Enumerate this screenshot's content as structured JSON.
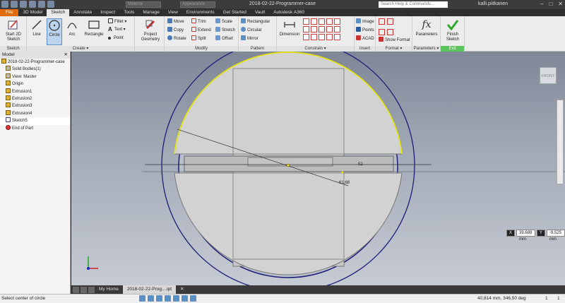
{
  "titlebar": {
    "material_field": "Material",
    "appearance_field": "Appearance",
    "document_title": "2018-02-22-Programmer-case",
    "search_placeholder": "Search Help & Commands...",
    "user_name": "kalli.piitkanen",
    "minimize": "–",
    "maximize": "□",
    "close": "✕"
  },
  "tabs": [
    "File",
    "3D Model",
    "Sketch",
    "Annotate",
    "Inspect",
    "Tools",
    "Manage",
    "View",
    "Environments",
    "Get Started",
    "Vault",
    "Autodesk A360"
  ],
  "active_tab": "Sketch",
  "ribbon": {
    "sketch_group": {
      "label": "Sketch",
      "start_2d_sketch": "Start 2D Sketch"
    },
    "create_group": {
      "label": "Create ▾",
      "line": "Line",
      "circle": "Circle",
      "arc": "Arc",
      "rectangle": "Rectangle",
      "fillet": "Fillet ▾",
      "text": "Text ▾",
      "point": "Point"
    },
    "project_geometry": "Project Geometry",
    "modify_group": {
      "label": "Modify",
      "move": "Move",
      "copy": "Copy",
      "rotate": "Rotate",
      "trim": "Trim",
      "extend": "Extend",
      "split": "Split",
      "scale": "Scale",
      "stretch": "Stretch",
      "offset": "Offset"
    },
    "pattern_group": {
      "label": "Pattern",
      "rectangular": "Rectangular",
      "circular": "Circular",
      "mirror": "Mirror"
    },
    "constrain_group": {
      "label": "Constrain ▾",
      "dimension": "Dimension"
    },
    "insert_group": {
      "label": "Insert",
      "image": "Image",
      "points": "Points",
      "acad": "ACAD"
    },
    "format_group": {
      "label": "Format ▾",
      "show_format": "Show Format"
    },
    "parameters_group": {
      "label": "Parameters ▾",
      "parameters": "Parameters",
      "fx": "fx"
    },
    "exit_group": {
      "label": "Exit",
      "finish_sketch": "Finish Sketch"
    }
  },
  "browser": {
    "title": "Model",
    "close": "✕",
    "items": [
      {
        "label": "2018-02-22-Programmer-case",
        "indent": 0
      },
      {
        "label": "Solid Bodies(1)",
        "indent": 1
      },
      {
        "label": "View: Master",
        "indent": 1
      },
      {
        "label": "Origin",
        "indent": 1
      },
      {
        "label": "Extrusion1",
        "indent": 1
      },
      {
        "label": "Extrusion2",
        "indent": 1
      },
      {
        "label": "Extrusion3",
        "indent": 1
      },
      {
        "label": "Extrusion4",
        "indent": 1
      },
      {
        "label": "Sketch5",
        "indent": 1
      },
      {
        "label": "End of Part",
        "indent": 1
      }
    ]
  },
  "viewport": {
    "viewcube_label": "FRONT",
    "dimension_horizontal": "52",
    "dimension_diameter": "61,68",
    "coord_x_label": "X",
    "coord_x_value": "39,688 mm",
    "coord_y_label": "Y",
    "coord_y_value": "-9,525 mm",
    "colors": {
      "outer_circle": "#1e1e7a",
      "arc_highlight": "#e6e600",
      "body_fill": "#d2d2d2"
    }
  },
  "doc_tabs": [
    "My Home",
    "2018-02-22-Prog....ipt"
  ],
  "doc_tab_close": "✕",
  "status": {
    "message": "Select center of circle",
    "coords": "40,814 mm, 346,50 deg",
    "page_a": "1",
    "page_b": "1"
  }
}
